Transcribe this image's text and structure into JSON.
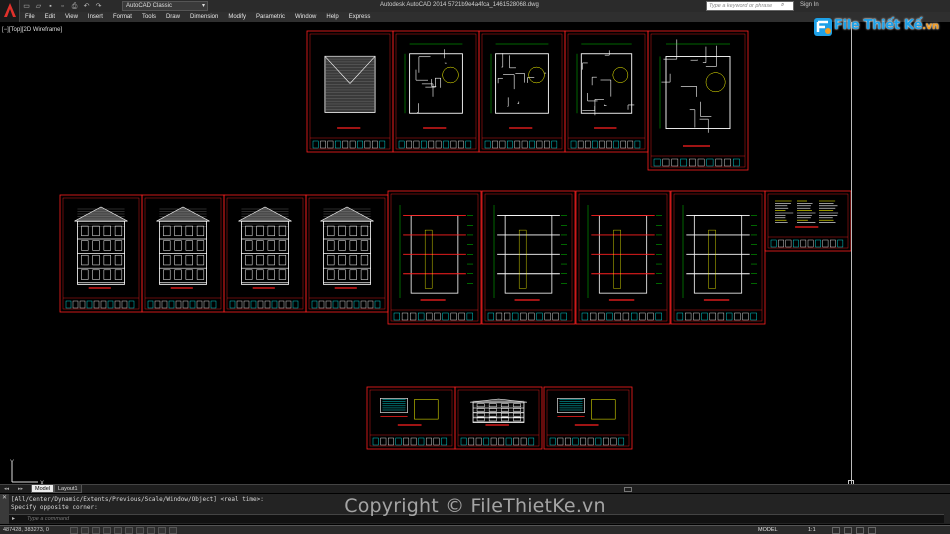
{
  "app": {
    "title": "Autodesk AutoCAD 2014    5721b9e4a4fca_1461528068.dwg",
    "workspace": "AutoCAD Classic"
  },
  "search": {
    "placeholder": "Type a keyword or phrase"
  },
  "signin": "Sign In",
  "menu": [
    "File",
    "Edit",
    "View",
    "Insert",
    "Format",
    "Tools",
    "Draw",
    "Dimension",
    "Modify",
    "Parametric",
    "Window",
    "Help",
    "Express"
  ],
  "viewport": {
    "label": "[−][Top][2D Wireframe]"
  },
  "tabs": {
    "model": "Model",
    "layout1": "Layout1"
  },
  "command": {
    "history": [
      "[All/Center/Dynamic/Extents/Previous/Scale/Window/Object] <real time>:",
      "Specify opposite corner:"
    ],
    "placeholder": "Type a command"
  },
  "status": {
    "coords": "487428, 383273, 0",
    "model": "MODEL",
    "scale": "1:1"
  },
  "watermark": {
    "logo_main": "File Thiết Kế",
    "logo_suffix": ".vn",
    "copyright": "Copyright © FileThietKe.vn"
  },
  "colors": {
    "frame": "#ff2020",
    "line_white": "#ffffff",
    "line_cyan": "#00ffff",
    "line_green": "#00ff00",
    "line_yellow": "#ffff00",
    "accent_blue": "#1ea0e6"
  },
  "icons": [
    "acad-logo-icon",
    "new-icon",
    "open-icon",
    "save-icon",
    "saveas-icon",
    "print-icon",
    "undo-icon",
    "redo-icon",
    "search-icon",
    "ucs-icon",
    "command-prompt-icon"
  ]
}
